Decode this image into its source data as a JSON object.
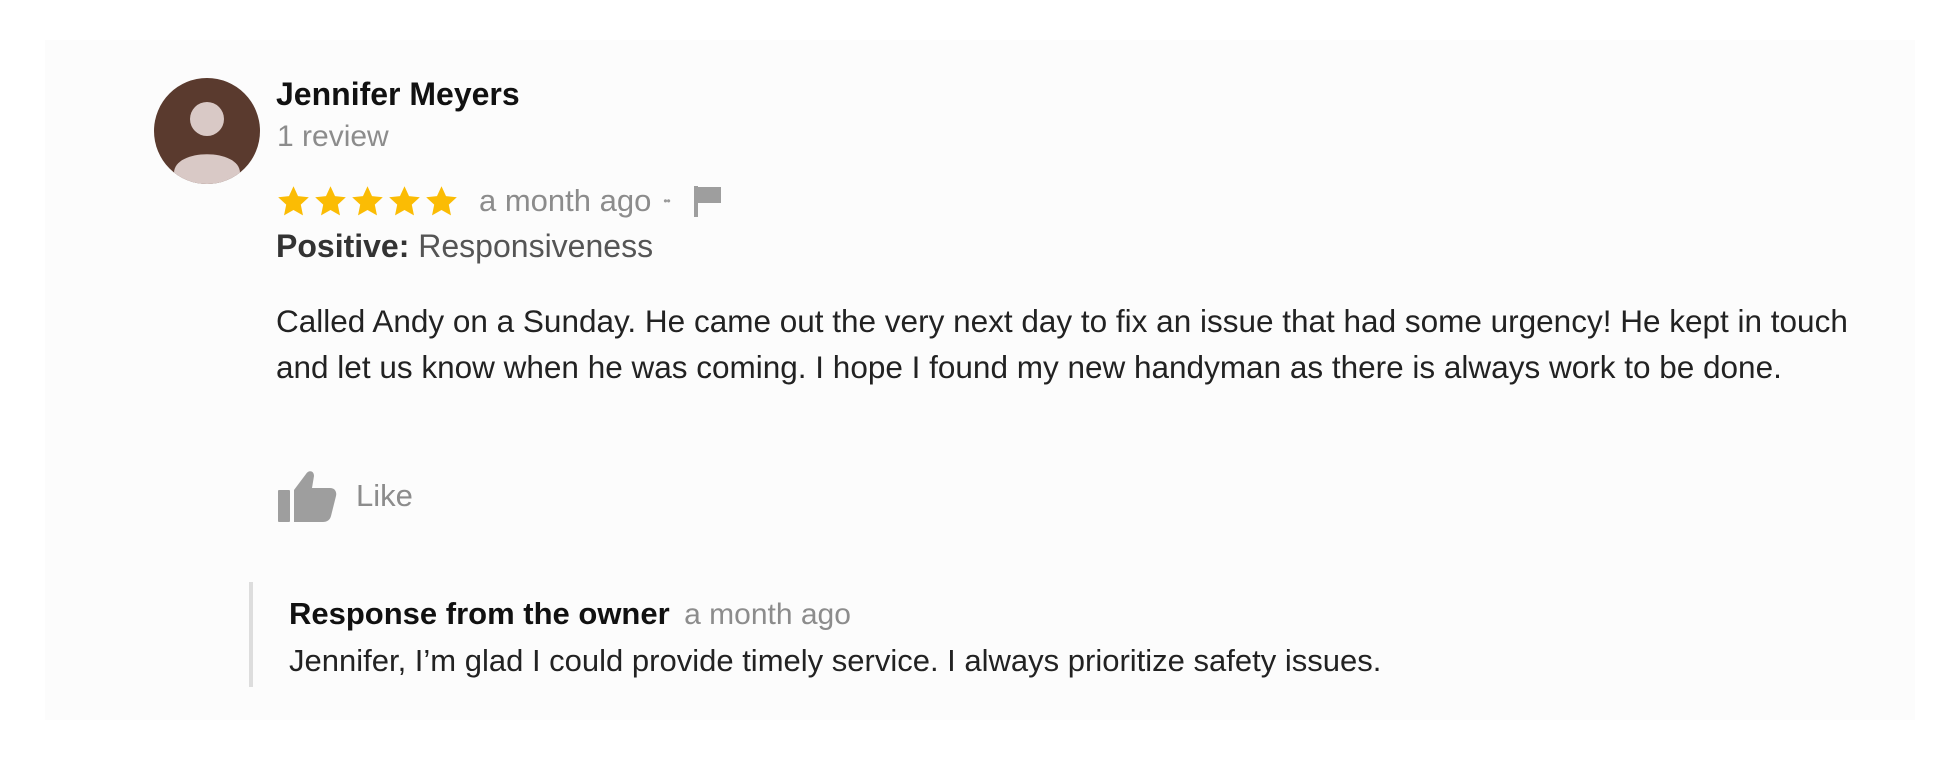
{
  "review": {
    "reviewer": {
      "name": "Jennifer Meyers",
      "review_count": "1 review",
      "avatar_icon": "person-silhouette-icon",
      "avatar_color": "#5a3a2e"
    },
    "rating": 5,
    "rating_max": 5,
    "star_color": "#fbbc04",
    "time": "a month ago",
    "dots": "••",
    "flag_icon": "flag-icon",
    "attribute_label": "Positive:",
    "attribute_value": "Responsiveness",
    "text": "Called Andy on a Sunday. He came out the very next day to fix an issue that had some urgency! He kept in touch and let us know when he was coming. I hope I found my new handyman as there is always work to be done.",
    "like": {
      "label": "Like",
      "icon": "thumbs-up-icon"
    }
  },
  "owner_response": {
    "title": "Response from the owner",
    "time": "a month ago",
    "text": "Jennifer, I’m glad I could provide timely service. I always prioritize safety issues."
  }
}
